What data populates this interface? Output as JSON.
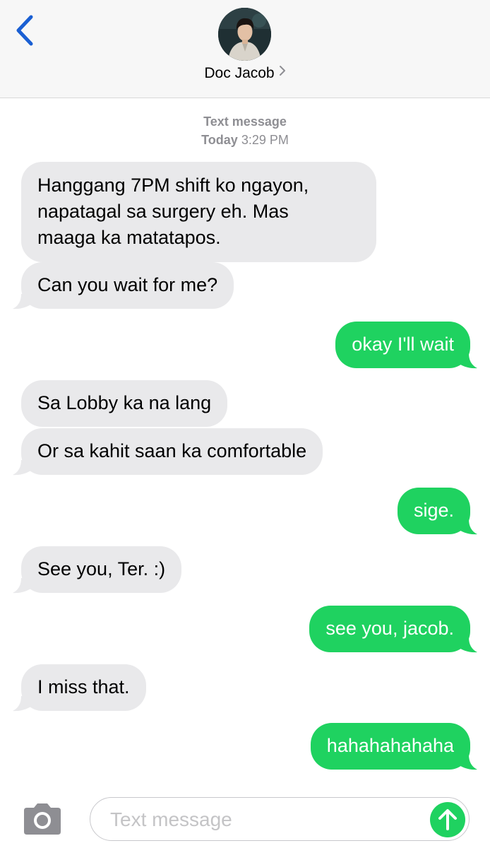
{
  "header": {
    "contact_name": "Doc Jacob",
    "back_icon": "chevron-left-icon",
    "chevron_icon": "chevron-right-icon"
  },
  "thread": {
    "service_label": "Text message",
    "day_label": "Today",
    "time_label": "3:29 PM"
  },
  "messages": [
    {
      "from": "contact",
      "lines": [
        "Hanggang 7PM shift ko ngayon,",
        "napatagal sa surgery eh. Mas",
        "maaga ka matatapos."
      ]
    },
    {
      "from": "contact",
      "text": "Can you wait for me?"
    },
    {
      "from": "me",
      "text": "okay I'll wait"
    },
    {
      "from": "contact",
      "text": "Sa Lobby ka na lang"
    },
    {
      "from": "contact",
      "text": "Or sa kahit saan ka comfortable"
    },
    {
      "from": "me",
      "text": "sige."
    },
    {
      "from": "contact",
      "text": "See you, Ter. :)"
    },
    {
      "from": "me",
      "text": "see you, jacob."
    },
    {
      "from": "contact",
      "text": "I miss that."
    },
    {
      "from": "me",
      "text": "hahahahahaha"
    }
  ],
  "composer": {
    "placeholder": "Text message",
    "camera_icon": "camera-icon",
    "send_icon": "send-arrow-icon"
  },
  "colors": {
    "incoming_bubble": "#e9e9eb",
    "outgoing_bubble": "#1fd260",
    "accent_blue": "#1a5fd3",
    "timestamp_gray": "#8e8e93"
  }
}
